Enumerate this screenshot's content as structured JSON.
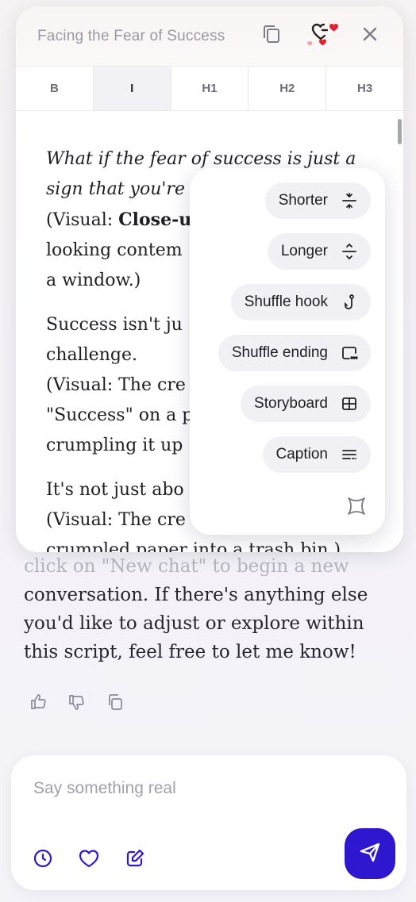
{
  "header": {
    "title": "Facing the Fear of Success",
    "copy_icon": "copy-icon",
    "favorite_icon": "heart-check-icon",
    "close_icon": "close-icon"
  },
  "toolbar": {
    "buttons": [
      "B",
      "I",
      "H1",
      "H2",
      "H3"
    ],
    "active": "I"
  },
  "document": {
    "p1_italic": "What if the fear of success is just a sign that you're",
    "p1_visual_open": "(Visual: ",
    "p1_visual_bold": "Close-u",
    "p1_l3": "looking contem",
    "p1_l4": "a window.)",
    "p2_l1": "Success isn't ju",
    "p2_l2": "challenge.",
    "p2_l3": "(Visual: The cre",
    "p2_l4": "\"Success\" on a p",
    "p2_l5": "crumpling it up",
    "p3_l1": "It's not just abo",
    "p3_l2": "(Visual: The cre",
    "p3_l3": "crumpled paper into a trash bin.)"
  },
  "menu": {
    "items": [
      {
        "label": "Shorter",
        "icon": "compress-icon"
      },
      {
        "label": "Longer",
        "icon": "expand-icon"
      },
      {
        "label": "Shuffle hook",
        "icon": "hook-icon"
      },
      {
        "label": "Shuffle ending",
        "icon": "ending-icon"
      },
      {
        "label": "Storyboard",
        "icon": "grid-icon"
      },
      {
        "label": "Caption",
        "icon": "caption-icon"
      }
    ],
    "magic_icon": "sparkle-icon"
  },
  "chat": {
    "faded_line": "click on \"New chat\" to begin a new",
    "message": "conversation. If there's anything else you'd like to adjust or explore within this script, feel free to let me know!"
  },
  "composer": {
    "placeholder": "Say something real",
    "value": ""
  },
  "colors": {
    "accent": "#2f16cf",
    "heart": "#e0222c"
  }
}
